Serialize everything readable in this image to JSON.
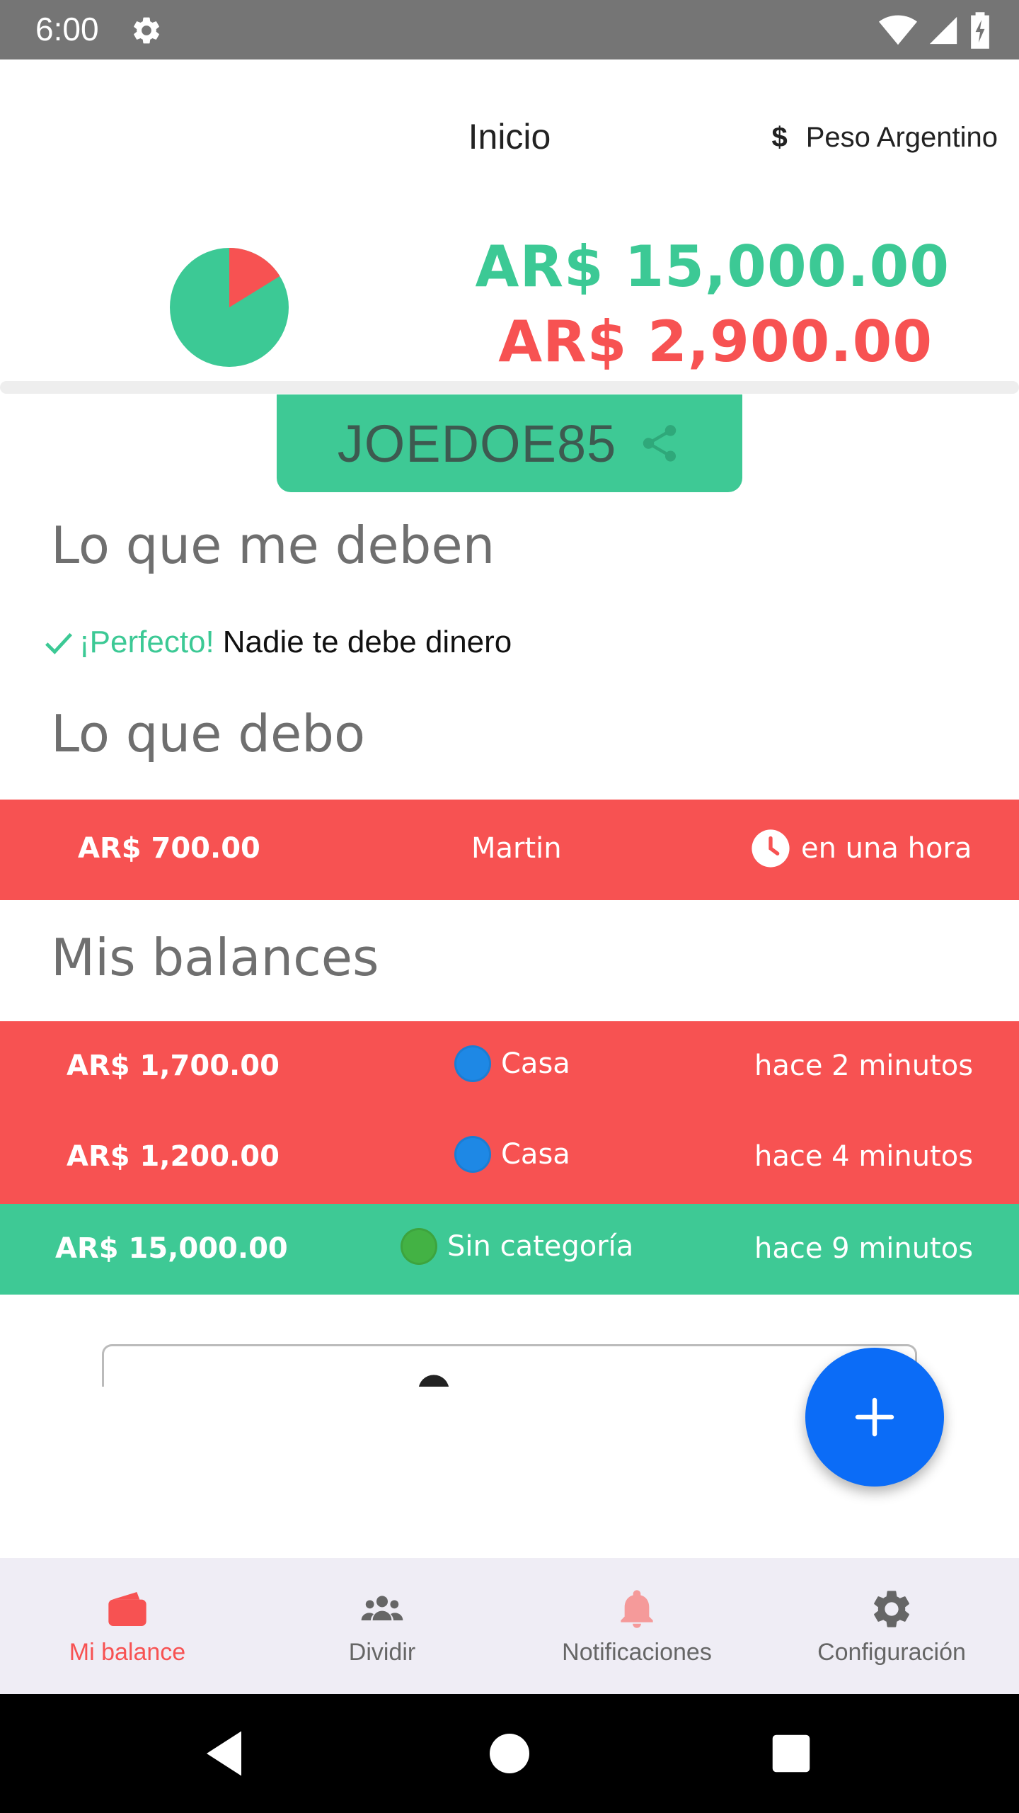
{
  "status_bar": {
    "time": "6:00"
  },
  "header": {
    "title": "Inicio",
    "currency_symbol": "$",
    "currency_name": "Peso Argentino"
  },
  "summary": {
    "total_positive": "AR$ 15,000.00",
    "total_negative": "AR$ 2,900.00",
    "pie": {
      "positive_fraction": 0.838,
      "negative_fraction": 0.162,
      "positive_color": "#3cc995",
      "negative_color": "#f75252"
    }
  },
  "user_code": {
    "code": "JOEDOE85"
  },
  "owed_section": {
    "title": "Lo que me deben",
    "perfect": "¡Perfecto!",
    "message": "Nadie te debe dinero"
  },
  "debts_section": {
    "title": "Lo que debo",
    "rows": [
      {
        "amount": "AR$ 700.00",
        "name": "Martin",
        "time": "en una hora"
      }
    ]
  },
  "balances_section": {
    "title": "Mis balances",
    "rows": [
      {
        "amount": "AR$ 1,700.00",
        "category": "Casa",
        "time": "hace 2 minutos",
        "row_color": "#f75252",
        "dot_color": "#1e88e5"
      },
      {
        "amount": "AR$ 1,200.00",
        "category": "Casa",
        "time": "hace 4 minutos",
        "row_color": "#f75252",
        "dot_color": "#1e88e5"
      },
      {
        "amount": "AR$ 15,000.00",
        "category": "Sin categoría",
        "time": "hace 9 minutos",
        "row_color": "#3ec995",
        "dot_color": "#43b244"
      }
    ]
  },
  "bottom_nav": {
    "items": [
      {
        "label": "Mi balance",
        "icon": "wallet-icon",
        "active": true
      },
      {
        "label": "Dividir",
        "icon": "group-icon",
        "active": false
      },
      {
        "label": "Notificaciones",
        "icon": "bell-icon",
        "active": false
      },
      {
        "label": "Configuración",
        "icon": "gear-icon",
        "active": false
      }
    ]
  },
  "colors": {
    "accent_green": "#3cc995",
    "accent_red": "#f75252",
    "fab_blue": "#0b6cf7"
  }
}
